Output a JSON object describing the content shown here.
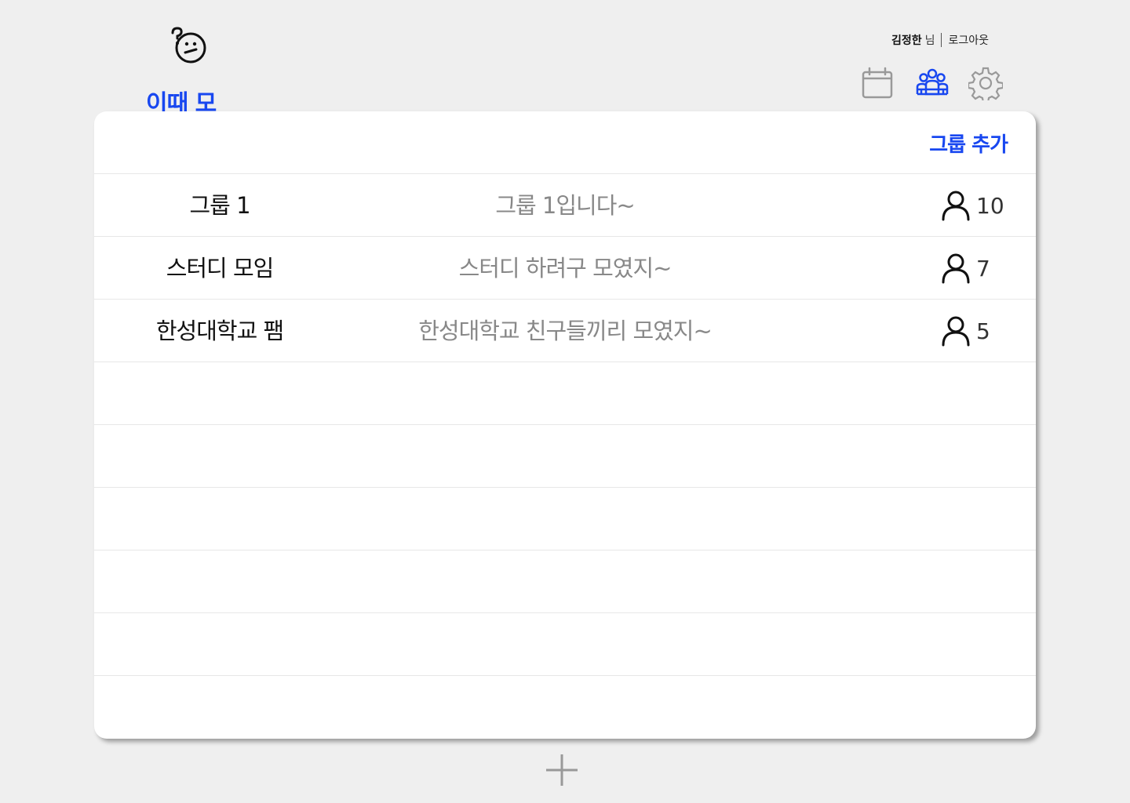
{
  "app": {
    "title": "이때 모해?"
  },
  "user": {
    "name": "김정한",
    "suffix": "님",
    "logout_label": "로그아웃"
  },
  "nav": [
    {
      "icon": "calendar-icon",
      "active": false
    },
    {
      "icon": "group-icon",
      "active": true
    },
    {
      "icon": "gear-icon",
      "active": false
    }
  ],
  "main": {
    "add_group_label": "그룹 추가",
    "groups": [
      {
        "name": "그룹 1",
        "description": "그룹 1입니다~",
        "members": "10"
      },
      {
        "name": "스터디 모임",
        "description": "스터디 하려구 모였지~",
        "members": "7"
      },
      {
        "name": "한성대학교 팸",
        "description": "한성대학교 친구들끼리 모였지~",
        "members": "5"
      }
    ],
    "empty_rows": 6
  },
  "colors": {
    "accent": "#1847f0",
    "muted": "#888888",
    "background": "#efefef"
  }
}
